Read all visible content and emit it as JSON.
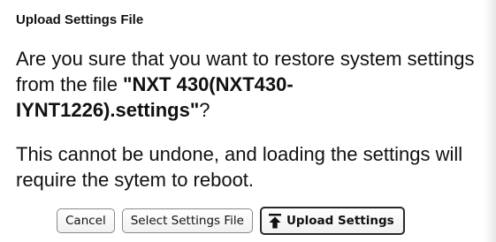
{
  "dialog": {
    "title": "Upload Settings File",
    "message_prefix": "Are you sure that you want to restore system settings from the file ",
    "open_quote": "\"",
    "file_name": "NXT 430(NXT430-IYNT1226).settings",
    "close_quote": "\"",
    "message_suffix": "?",
    "warning": "This cannot be undone, and loading the settings will require the sytem to reboot."
  },
  "buttons": {
    "cancel_label": "Cancel",
    "select_label": "Select Settings File",
    "upload_label": "Upload Settings",
    "upload_icon": "upload-arrow-icon"
  }
}
